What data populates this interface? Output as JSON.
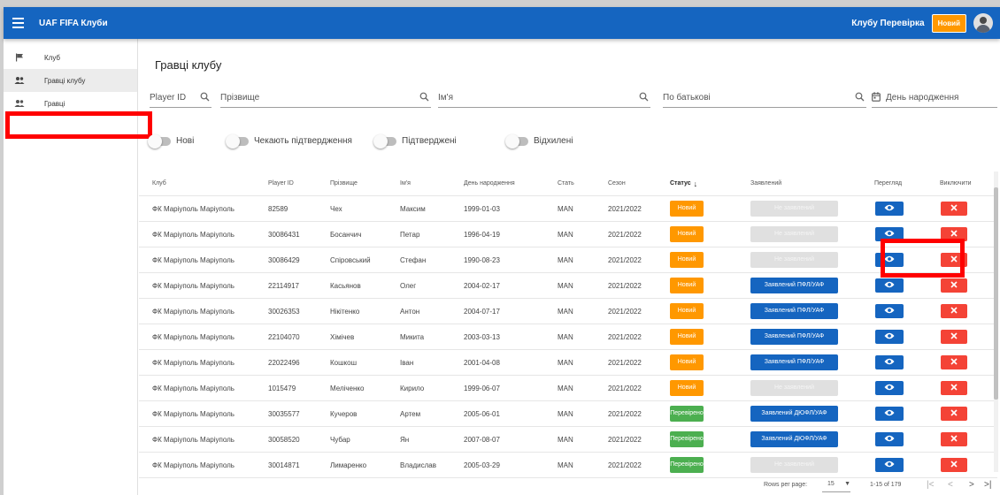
{
  "app": {
    "title": "UAF FIFA Клуби"
  },
  "header": {
    "user_name": "Клубу Перевірка",
    "status_chip": "Новий"
  },
  "sidebar": {
    "items": [
      {
        "label": "Клуб",
        "icon": "flag-icon",
        "active": false
      },
      {
        "label": "Гравці клубу",
        "icon": "people-icon",
        "active": true
      },
      {
        "label": "Гравці",
        "icon": "people-icon",
        "active": false
      }
    ]
  },
  "page": {
    "title": "Гравці клубу"
  },
  "filters": {
    "player_id": "Player ID",
    "surname": "Прізвище",
    "name": "Ім'я",
    "patronymic": "По батькові",
    "birthday": "День народження"
  },
  "toggles": [
    {
      "label": "Нові"
    },
    {
      "label": "Чекають підтвердження"
    },
    {
      "label": "Підтверджені"
    },
    {
      "label": "Відхилені"
    }
  ],
  "table": {
    "headers": {
      "club": "Клуб",
      "player_id": "Player ID",
      "surname": "Прізвище",
      "name": "Ім'я",
      "birthday": "День народження",
      "sex": "Стать",
      "season": "Сезон",
      "status": "Статус",
      "declared": "Заявлений",
      "view": "Перегляд",
      "exclude": "Виключити"
    },
    "rows": [
      {
        "club": "ФК Маріуполь Маріуполь",
        "player_id": "82589",
        "surname": "Чех",
        "name": "Максим",
        "birthday": "1999-01-03",
        "sex": "MAN",
        "season": "2021/2022",
        "status": "Новий",
        "declared": "Не заявлений"
      },
      {
        "club": "ФК Маріуполь Маріуполь",
        "player_id": "30086431",
        "surname": "Босанчич",
        "name": "Петар",
        "birthday": "1996-04-19",
        "sex": "MAN",
        "season": "2021/2022",
        "status": "Новий",
        "declared": "Не заявлений"
      },
      {
        "club": "ФК Маріуполь Маріуполь",
        "player_id": "30086429",
        "surname": "Спіровський",
        "name": "Стефан",
        "birthday": "1990-08-23",
        "sex": "MAN",
        "season": "2021/2022",
        "status": "Новий",
        "declared": "Не заявлений"
      },
      {
        "club": "ФК Маріуполь Маріуполь",
        "player_id": "22114917",
        "surname": "Касьянов",
        "name": "Олег",
        "birthday": "2004-02-17",
        "sex": "MAN",
        "season": "2021/2022",
        "status": "Новий",
        "declared": "Заявлений ПФЛ/УАФ"
      },
      {
        "club": "ФК Маріуполь Маріуполь",
        "player_id": "30026353",
        "surname": "Нікітенко",
        "name": "Антон",
        "birthday": "2004-07-17",
        "sex": "MAN",
        "season": "2021/2022",
        "status": "Новий",
        "declared": "Заявлений ПФЛ/УАФ"
      },
      {
        "club": "ФК Маріуполь Маріуполь",
        "player_id": "22104070",
        "surname": "Хімічев",
        "name": "Микита",
        "birthday": "2003-03-13",
        "sex": "MAN",
        "season": "2021/2022",
        "status": "Новий",
        "declared": "Заявлений ПФЛ/УАФ"
      },
      {
        "club": "ФК Маріуполь Маріуполь",
        "player_id": "22022496",
        "surname": "Кошкош",
        "name": "Іван",
        "birthday": "2001-04-08",
        "sex": "MAN",
        "season": "2021/2022",
        "status": "Новий",
        "declared": "Заявлений ПФЛ/УАФ"
      },
      {
        "club": "ФК Маріуполь Маріуполь",
        "player_id": "1015479",
        "surname": "Меліченко",
        "name": "Кирило",
        "birthday": "1999-06-07",
        "sex": "MAN",
        "season": "2021/2022",
        "status": "Новий",
        "declared": "Не заявлений"
      },
      {
        "club": "ФК Маріуполь Маріуполь",
        "player_id": "30035577",
        "surname": "Кучеров",
        "name": "Артем",
        "birthday": "2005-06-01",
        "sex": "MAN",
        "season": "2021/2022",
        "status": "Перевірено",
        "declared": "Заявлений ДЮФЛ/УАФ"
      },
      {
        "club": "ФК Маріуполь Маріуполь",
        "player_id": "30058520",
        "surname": "Чубар",
        "name": "Ян",
        "birthday": "2007-08-07",
        "sex": "MAN",
        "season": "2021/2022",
        "status": "Перевірено",
        "declared": "Заявлений ДЮФЛ/УАФ"
      },
      {
        "club": "ФК Маріуполь Маріуполь",
        "player_id": "30014871",
        "surname": "Лимаренко",
        "name": "Владислав",
        "birthday": "2005-03-29",
        "sex": "MAN",
        "season": "2021/2022",
        "status": "Перевірено",
        "declared": "Не заявлений"
      }
    ]
  },
  "pagination": {
    "rows_per_page_label": "Rows per page:",
    "rows_per_page_value": "15",
    "range_text": "1-15 of 179"
  },
  "colors": {
    "appbar": "#1565c0",
    "status_new": "#ff9800",
    "status_checked": "#4caf50",
    "declared": "#1565c0",
    "not_declared": "#e0e0e0",
    "delete": "#f44336",
    "annotation": "#ff0000"
  }
}
